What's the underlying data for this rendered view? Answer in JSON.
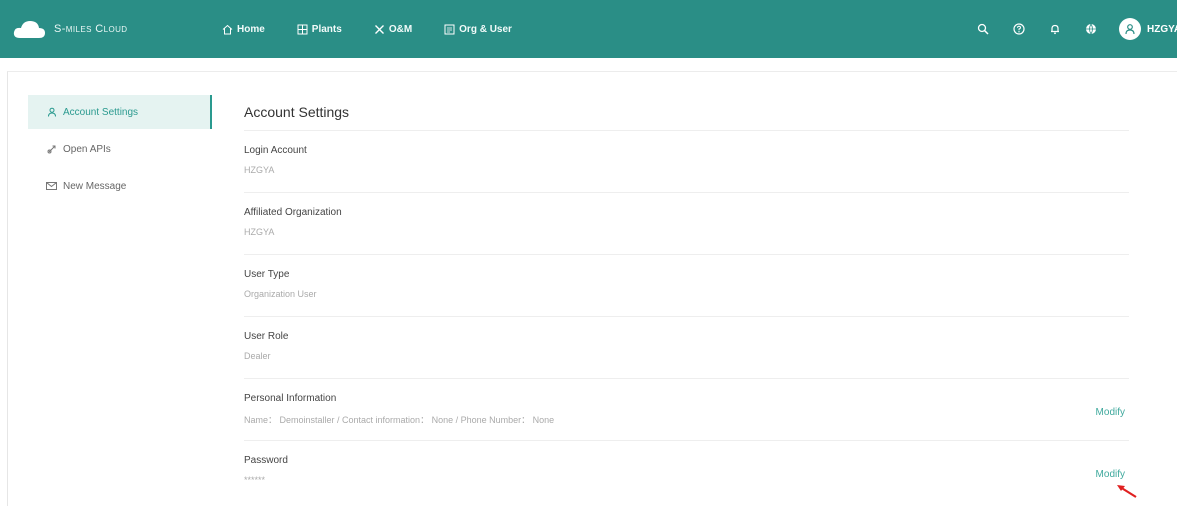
{
  "brand": {
    "name": "S-miles Cloud"
  },
  "nav": [
    {
      "label": "Home",
      "icon": "home-icon"
    },
    {
      "label": "Plants",
      "icon": "plants-icon"
    },
    {
      "label": "O&M",
      "icon": "tools-icon"
    },
    {
      "label": "Org & User",
      "icon": "org-icon"
    }
  ],
  "header_icons": [
    "search-icon",
    "help-icon",
    "bell-icon",
    "globe-icon"
  ],
  "user": {
    "name": "HZGYA"
  },
  "sidebar": {
    "items": [
      {
        "label": "Account Settings",
        "icon": "user-icon",
        "active": true
      },
      {
        "label": "Open APIs",
        "icon": "link-icon",
        "active": false
      },
      {
        "label": "New Message",
        "icon": "mail-icon",
        "active": false
      }
    ]
  },
  "main": {
    "title": "Account Settings",
    "rows": [
      {
        "label": "Login Account",
        "value": "HZGYA"
      },
      {
        "label": "Affiliated Organization",
        "value": "HZGYA"
      },
      {
        "label": "User Type",
        "value": "Organization User"
      },
      {
        "label": "User Role",
        "value": "Dealer"
      },
      {
        "label": "Personal Information",
        "value": "Name： Demoinstaller / Contact information： None / Phone Number： None",
        "action": "Modify"
      },
      {
        "label": "Password",
        "value": "******",
        "action": "Modify"
      }
    ]
  },
  "colors": {
    "primary": "#2a8e86",
    "accent": "#3fa99d",
    "active_bg": "#e5f3f1",
    "annotation_arrow": "#e02020"
  }
}
